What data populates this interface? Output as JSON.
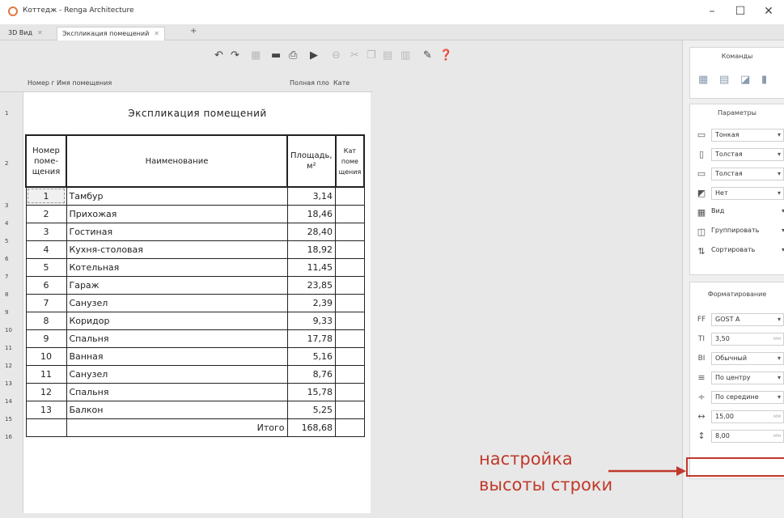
{
  "window": {
    "title": "Коттедж - Renga Architecture",
    "controls": {
      "minimize": "–",
      "maximize": "☐",
      "close": "✕"
    }
  },
  "tabs": [
    {
      "label": "3D Вид",
      "close": "✕"
    },
    {
      "label": "Экспликация помещений",
      "close": "✕"
    }
  ],
  "tab_add": "+",
  "toolbar": {
    "icons": [
      "undo-icon",
      "redo-icon",
      "insert-icon",
      "table-icon",
      "print-icon",
      "export-icon",
      "lock-icon",
      "cut-icon",
      "copy-icon",
      "paste-icon",
      "grid-icon",
      "wrench-icon",
      "help-icon"
    ]
  },
  "sheet": {
    "column_headers": [
      "Номер г",
      "Имя помещения",
      "Полная пло",
      "Кате"
    ],
    "row_numbers": [
      "1",
      "2",
      "3",
      "4",
      "5",
      "6",
      "7",
      "8",
      "9",
      "10",
      "11",
      "12",
      "13",
      "14",
      "15",
      "16"
    ],
    "title": "Экспликация помещений",
    "headers": {
      "number": "Номер поме-щения",
      "name": "Наименование",
      "area": "Площадь, м²",
      "category": "Кат поме щения"
    },
    "rows": [
      {
        "num": "1",
        "name": "Тамбур",
        "area": "3,14"
      },
      {
        "num": "2",
        "name": "Прихожая",
        "area": "18,46"
      },
      {
        "num": "3",
        "name": "Гостиная",
        "area": "28,40"
      },
      {
        "num": "4",
        "name": "Кухня-столовая",
        "area": "18,92"
      },
      {
        "num": "5",
        "name": "Котельная",
        "area": "11,45"
      },
      {
        "num": "6",
        "name": "Гараж",
        "area": "23,85"
      },
      {
        "num": "7",
        "name": "Санузел",
        "area": "2,39"
      },
      {
        "num": "8",
        "name": "Коридор",
        "area": "9,33"
      },
      {
        "num": "9",
        "name": "Спальня",
        "area": "17,78"
      },
      {
        "num": "10",
        "name": "Ванная",
        "area": "5,16"
      },
      {
        "num": "11",
        "name": "Санузел",
        "area": "8,76"
      },
      {
        "num": "12",
        "name": "Спальня",
        "area": "15,78"
      },
      {
        "num": "13",
        "name": "Балкон",
        "area": "5,25"
      }
    ],
    "total_label": "Итого",
    "total_value": "168,68"
  },
  "right_panel": {
    "commands_title": "Команды",
    "params_title": "Параметры",
    "params": [
      {
        "icon": "line-thin-icon",
        "value": "Тонкая"
      },
      {
        "icon": "line-thick-side-icon",
        "value": "Толстая"
      },
      {
        "icon": "border-thick-icon",
        "value": "Толстая"
      },
      {
        "icon": "fill-icon",
        "value": "Нет"
      },
      {
        "icon": "view-grid-icon",
        "value": "Вид"
      },
      {
        "icon": "group-icon",
        "value": "Группировать"
      },
      {
        "icon": "sort-icon",
        "value": "Сортировать"
      }
    ],
    "format_title": "Форматирование",
    "format": [
      {
        "glyph": "FF",
        "value": "GOST A",
        "unit": ""
      },
      {
        "glyph": "TI",
        "value": "3,50",
        "unit": "мм"
      },
      {
        "glyph": "BI",
        "value": "Обычный",
        "unit": ""
      },
      {
        "glyph": "≡",
        "value": "По центру",
        "unit": ""
      },
      {
        "glyph": "÷",
        "value": "По середине",
        "unit": ""
      },
      {
        "glyph": "↔",
        "value": "15,00",
        "unit": "мм"
      },
      {
        "glyph": "↕",
        "value": "8,00",
        "unit": "мм"
      }
    ]
  },
  "annotation": {
    "line1": "настройка",
    "line2": "высоты строки",
    "color": "#c0392b"
  }
}
